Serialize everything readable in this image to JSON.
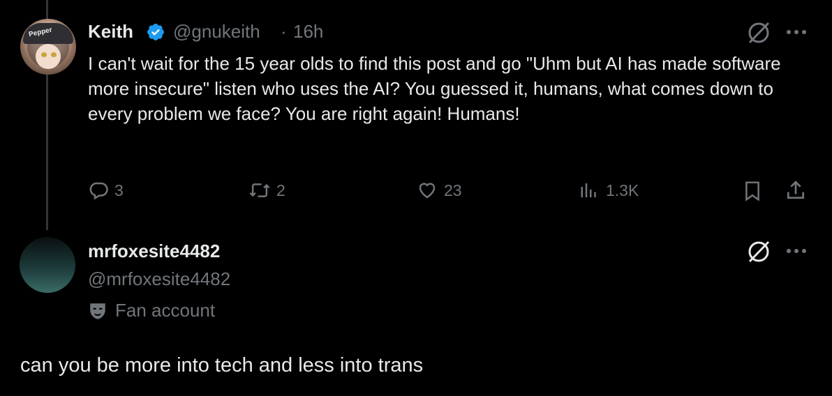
{
  "tweet": {
    "author_name": "Keith",
    "handle": "@gnukeith",
    "separator": "·",
    "time": "16h",
    "avatar_cap_text": "Pepper",
    "text": "I can't wait for the 15 year olds to find this post and go \"Uhm but AI has made software more insecure\" listen who uses the AI? You guessed it, humans, what comes down to every problem we face? You are right again! Humans!",
    "actions": {
      "replies": "3",
      "reposts": "2",
      "likes": "23",
      "views": "1.3K"
    }
  },
  "reply": {
    "author_name": "mrfoxesite4482",
    "handle": "@mrfoxesite4482",
    "badge_label": "Fan account",
    "text": "can you be more into tech and less into trans"
  },
  "colors": {
    "background": "#000000",
    "text": "#e7e9ea",
    "muted": "#71767b",
    "verified": "#1d9bf0"
  },
  "icons": [
    "verified-badge-icon",
    "grok-icon",
    "more-icon",
    "reply-icon",
    "repost-icon",
    "like-icon",
    "views-icon",
    "bookmark-icon",
    "share-icon",
    "mask-icon"
  ]
}
